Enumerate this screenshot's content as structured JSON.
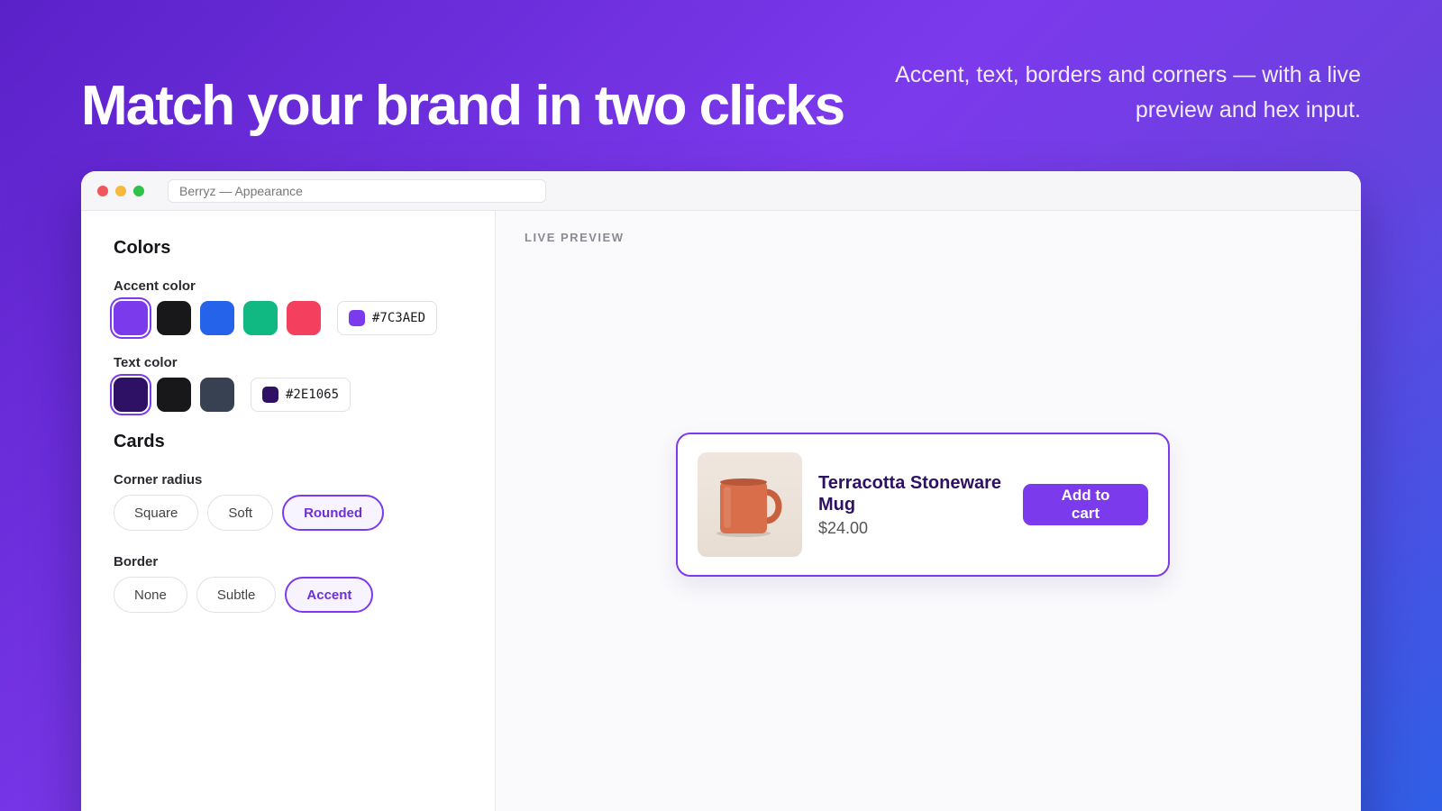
{
  "hero": {
    "title": "Match your brand in two clicks",
    "subtitle": "Accent, text, borders and corners — with a live preview and hex input."
  },
  "window": {
    "url": "Berryz — Appearance"
  },
  "colors": {
    "title": "Colors",
    "accent": {
      "label": "Accent color",
      "swatches": [
        "#7c3aed",
        "#18181b",
        "#2563eb",
        "#10b981",
        "#f43f5e"
      ],
      "selected_index": 0,
      "hex": "#7C3AED"
    },
    "text": {
      "label": "Text color",
      "swatches": [
        "#2e1065",
        "#18181b",
        "#374151"
      ],
      "selected_index": 0,
      "hex": "#2E1065"
    }
  },
  "cards": {
    "title": "Cards",
    "corner": {
      "label": "Corner radius",
      "options": [
        "Square",
        "Soft",
        "Rounded"
      ],
      "selected": "Rounded"
    },
    "border": {
      "label": "Border",
      "options": [
        "None",
        "Subtle",
        "Accent"
      ],
      "selected": "Accent"
    }
  },
  "preview": {
    "label": "LIVE PREVIEW",
    "product": {
      "name": "Terracotta Stoneware Mug",
      "price": "$24.00",
      "button": "Add to cart",
      "image_icon": "mug-icon"
    }
  }
}
